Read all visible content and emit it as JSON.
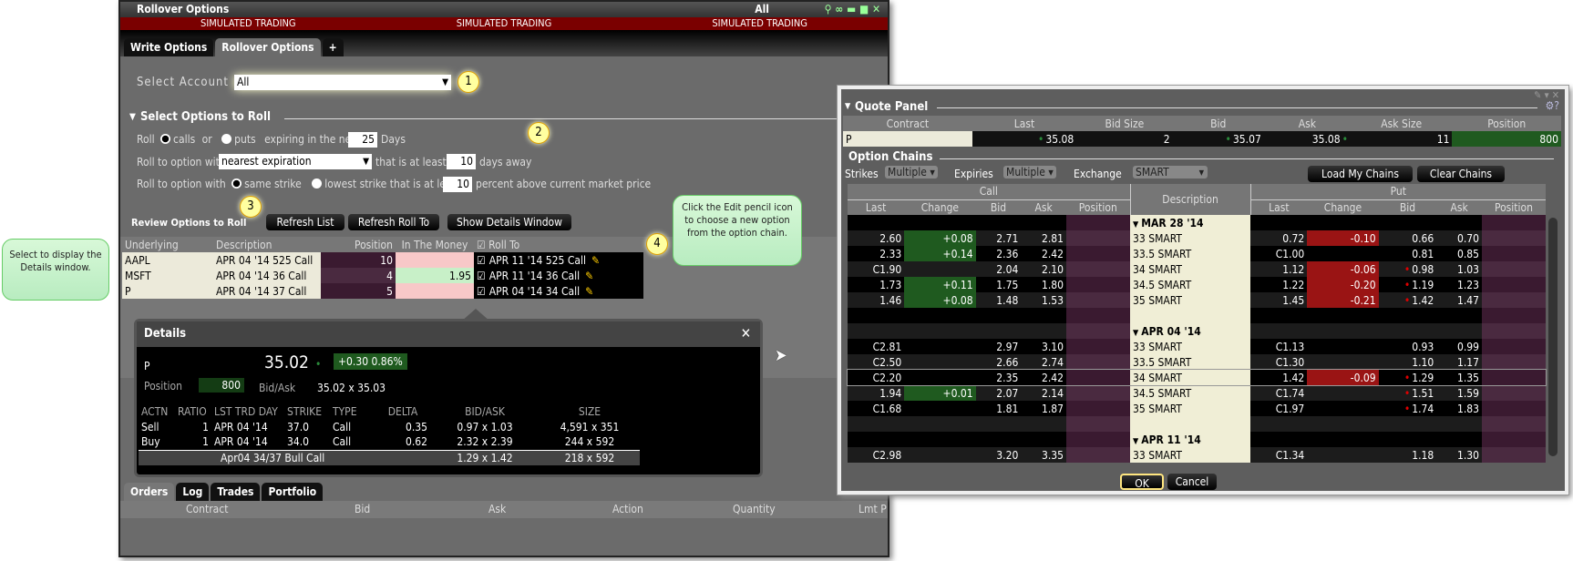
{
  "rollover": {
    "title": "Rollover Options",
    "title_right": "All",
    "banner": [
      "SIMULATED TRADING",
      "SIMULATED TRADING",
      "SIMULATED TRADING"
    ],
    "tabs": [
      "Write Options",
      "Rollover Options",
      "+"
    ],
    "select_account_label": "Select Account",
    "account_value": "All",
    "section_title": "Select Options to Roll",
    "roll_label": "Roll",
    "calls_label": "calls",
    "or_label": "or",
    "puts_label": "puts",
    "expiring_label": "expiring in the next",
    "days_value": "25",
    "days_label": "Days",
    "roll_to_label": "Roll to option with",
    "expiration_value": "nearest expiration",
    "at_least_label": "that is at least",
    "days_away_value": "10",
    "days_away_label": "days away",
    "roll_to_label2": "Roll to option with",
    "same_strike_label": "same strike",
    "lowest_strike_label": "lowest strike that is at least",
    "percent_value": "10",
    "percent_label": "percent above current market price",
    "review_label": "Review Options to Roll",
    "buttons": [
      "Refresh List",
      "Refresh Roll To",
      "Show Details Window"
    ],
    "table_headers": [
      "Underlying",
      "Description",
      "Position",
      "In The Money",
      "Roll To"
    ],
    "rows": [
      {
        "underlying": "AAPL",
        "description": "APR 04 '14 525 Call",
        "position": "10",
        "itm": "",
        "roll_to": "APR 11 '14 525 Call"
      },
      {
        "underlying": "MSFT",
        "description": "APR 04 '14 36 Call",
        "position": "4",
        "itm": "1.95",
        "roll_to": "APR 11 '14 36 Call"
      },
      {
        "underlying": "P",
        "description": "APR 04 '14 37 Call",
        "position": "5",
        "itm": "",
        "roll_to": "APR 04 '14 34 Call"
      }
    ],
    "bottom_tabs": [
      "Orders",
      "Log",
      "Trades",
      "Portfolio"
    ],
    "bottom_headers": [
      "Contract",
      "Bid",
      "Ask",
      "Action",
      "Quantity",
      "Lmt P"
    ]
  },
  "badges": [
    "1",
    "2",
    "3",
    "4"
  ],
  "callouts": {
    "left": "Select to display the Details window.",
    "right": "Click the Edit pencil icon to choose a new option from the option chain."
  },
  "details": {
    "title": "Details",
    "symbol": "P",
    "price": "35.02",
    "change": "+0.30 0.86%",
    "position_label": "Position",
    "position": "800",
    "bidask_label": "Bid/Ask",
    "bidask": "35.02 x 35.03",
    "headers": [
      "ACTN",
      "RATIO",
      "LST TRD DAY",
      "STRIKE",
      "TYPE",
      "DELTA",
      "BID/ASK",
      "SIZE"
    ],
    "legs": [
      [
        "Sell",
        "1",
        "APR 04 '14",
        "37.0",
        "Call",
        "0.35",
        "0.97 x 1.03",
        "4,591 x 351"
      ],
      [
        "Buy",
        "1",
        "APR 04 '14",
        "34.0",
        "Call",
        "0.62",
        "2.32 x 2.39",
        "244 x 592"
      ]
    ],
    "combo": {
      "name": "Apr04 34/37 Bull Call",
      "bidask": "1.29 x 1.42",
      "size": "218 x 592"
    }
  },
  "quote": {
    "title": "Quote Panel",
    "headers": [
      "Contract",
      "Last",
      "Bid Size",
      "Bid",
      "Ask",
      "Ask Size",
      "Position"
    ],
    "row": [
      "P",
      "35.08",
      "2",
      "35.07",
      "35.08",
      "11",
      "800"
    ],
    "chains_title": "Option Chains",
    "strikes_label": "Strikes",
    "strikes_value": "Multiple",
    "expiries_label": "Expiries",
    "expiries_value": "Multiple",
    "exchange_label": "Exchange",
    "exchange_value": "SMART",
    "load_label": "Load My Chains",
    "clear_label": "Clear Chains",
    "call_label": "Call",
    "put_label": "Put",
    "desc_label": "Description",
    "sub_headers": [
      "Last",
      "Change",
      "Bid",
      "Ask",
      "Position"
    ],
    "chain_rows": [
      {
        "h": "MAR 28 '14"
      },
      {
        "c": [
          "2.60",
          "+0.08",
          "2.71",
          "2.81"
        ],
        "d": "33 SMART",
        "p": [
          "0.72",
          "-0.10",
          "0.66",
          "0.70"
        ]
      },
      {
        "c": [
          "2.33",
          "+0.14",
          "2.36",
          "2.42"
        ],
        "d": "33.5 SMART",
        "p": [
          "C1.00",
          "",
          "0.81",
          "0.85"
        ]
      },
      {
        "c": [
          "C1.90",
          "",
          "2.04",
          "2.10"
        ],
        "d": "34 SMART",
        "p": [
          "1.12",
          "-0.06",
          "0.98",
          "1.03"
        ]
      },
      {
        "c": [
          "1.73",
          "+0.11",
          "1.75",
          "1.80"
        ],
        "d": "34.5 SMART",
        "p": [
          "1.22",
          "-0.20",
          "1.19",
          "1.23"
        ]
      },
      {
        "c": [
          "1.46",
          "+0.08",
          "1.48",
          "1.53"
        ],
        "d": "35 SMART",
        "p": [
          "1.45",
          "-0.21",
          "1.42",
          "1.47"
        ]
      },
      {
        "e": true
      },
      {
        "h": "APR 04 '14"
      },
      {
        "c": [
          "C2.81",
          "",
          "2.97",
          "3.10"
        ],
        "d": "33 SMART",
        "p": [
          "C1.13",
          "",
          "0.93",
          "0.99"
        ]
      },
      {
        "c": [
          "C2.50",
          "",
          "2.66",
          "2.74"
        ],
        "d": "33.5 SMART",
        "p": [
          "C1.30",
          "",
          "1.10",
          "1.17"
        ]
      },
      {
        "c": [
          "C2.20",
          "",
          "2.35",
          "2.42"
        ],
        "d": "34 SMART",
        "p": [
          "1.42",
          "-0.09",
          "1.29",
          "1.35"
        ],
        "sel": true
      },
      {
        "c": [
          "1.94",
          "+0.01",
          "2.07",
          "2.14"
        ],
        "d": "34.5 SMART",
        "p": [
          "C1.74",
          "",
          "1.51",
          "1.59"
        ]
      },
      {
        "c": [
          "C1.68",
          "",
          "1.81",
          "1.87"
        ],
        "d": "35 SMART",
        "p": [
          "C1.97",
          "",
          "1.74",
          "1.83"
        ]
      },
      {
        "e": true
      },
      {
        "h": "APR 11 '14"
      },
      {
        "c": [
          "C2.98",
          "",
          "3.20",
          "3.35"
        ],
        "d": "33 SMART",
        "p": [
          "C1.34",
          "",
          "1.18",
          "1.30"
        ]
      }
    ],
    "ok_label": "OK",
    "cancel_label": "Cancel"
  },
  "colors": {
    "banner": "#7a0000",
    "positive": "#1f5a1f",
    "negative": "#9a1414",
    "description_bg": "#f0eed6"
  }
}
